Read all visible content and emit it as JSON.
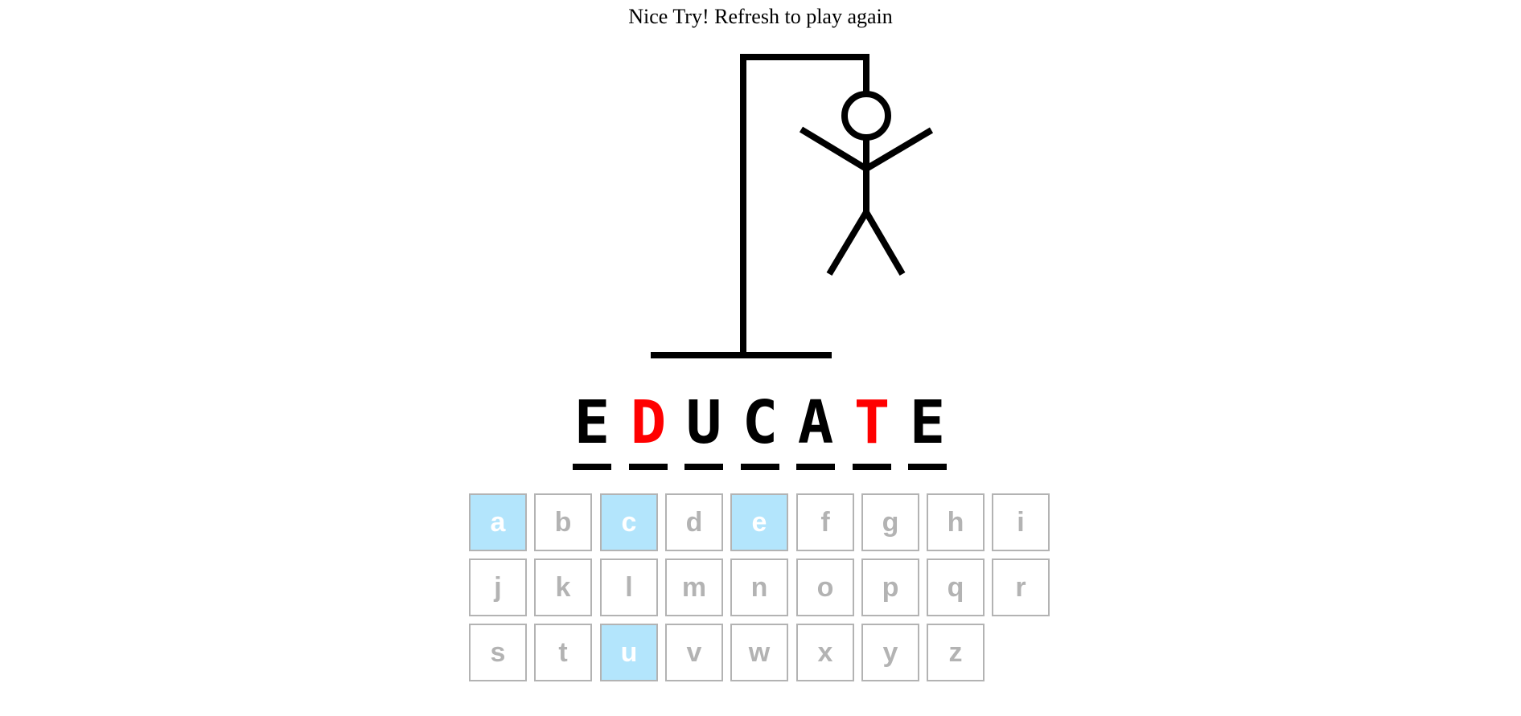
{
  "status_message": "Nice Try! Refresh to play again",
  "colors": {
    "revealed": "#000000",
    "missed": "#ff0000",
    "key_border": "#b3b3b3",
    "key_text": "#b3b3b3",
    "used_key_bg": "#b3e5fc",
    "used_key_text": "#ffffff"
  },
  "hangman_parts_shown": [
    "head",
    "body",
    "left-arm",
    "right-arm",
    "left-leg",
    "right-leg"
  ],
  "word": [
    {
      "letter": "E",
      "state": "revealed"
    },
    {
      "letter": "D",
      "state": "missed"
    },
    {
      "letter": "U",
      "state": "revealed"
    },
    {
      "letter": "C",
      "state": "revealed"
    },
    {
      "letter": "A",
      "state": "revealed"
    },
    {
      "letter": "T",
      "state": "missed"
    },
    {
      "letter": "E",
      "state": "revealed"
    }
  ],
  "keyboard": {
    "rows": [
      [
        {
          "letter": "a",
          "used": true
        },
        {
          "letter": "b",
          "used": false
        },
        {
          "letter": "c",
          "used": true
        },
        {
          "letter": "d",
          "used": false
        },
        {
          "letter": "e",
          "used": true
        },
        {
          "letter": "f",
          "used": false
        },
        {
          "letter": "g",
          "used": false
        },
        {
          "letter": "h",
          "used": false
        },
        {
          "letter": "i",
          "used": false
        }
      ],
      [
        {
          "letter": "j",
          "used": false
        },
        {
          "letter": "k",
          "used": false
        },
        {
          "letter": "l",
          "used": false
        },
        {
          "letter": "m",
          "used": false
        },
        {
          "letter": "n",
          "used": false
        },
        {
          "letter": "o",
          "used": false
        },
        {
          "letter": "p",
          "used": false
        },
        {
          "letter": "q",
          "used": false
        },
        {
          "letter": "r",
          "used": false
        }
      ],
      [
        {
          "letter": "s",
          "used": false
        },
        {
          "letter": "t",
          "used": false
        },
        {
          "letter": "u",
          "used": true
        },
        {
          "letter": "v",
          "used": false
        },
        {
          "letter": "w",
          "used": false
        },
        {
          "letter": "x",
          "used": false
        },
        {
          "letter": "y",
          "used": false
        },
        {
          "letter": "z",
          "used": false
        }
      ]
    ]
  }
}
